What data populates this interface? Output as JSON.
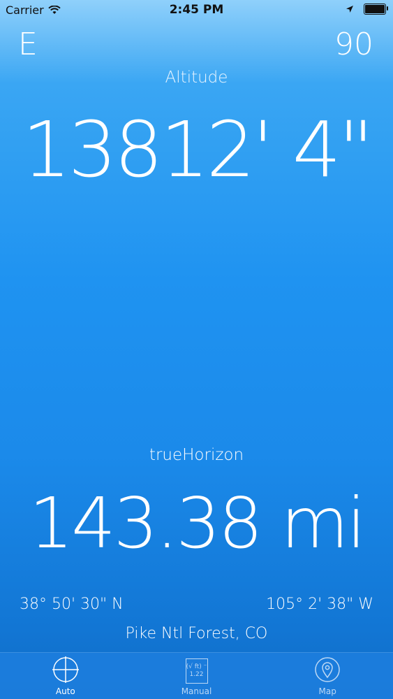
{
  "status": {
    "carrier": "Carrier",
    "time": "2:45 PM"
  },
  "heading": {
    "direction": "E",
    "degrees": "90"
  },
  "altitude": {
    "label": "Altitude",
    "value": "13812' 4\""
  },
  "horizon": {
    "label": "trueHorizon",
    "value": "143.38 mi"
  },
  "location": {
    "latitude": "38° 50' 30\" N",
    "longitude": "105° 2' 38\" W",
    "place": "Pike Ntl Forest, CO"
  },
  "tabs": [
    {
      "label": "Auto",
      "icon": "crosshair-icon",
      "active": true
    },
    {
      "label": "Manual",
      "icon": "manual-sqrt-icon",
      "active": false,
      "icon_text_top": "(√ ft) ⁻",
      "icon_text_bottom": "1.22"
    },
    {
      "label": "Map",
      "icon": "map-pin-icon",
      "active": false
    }
  ],
  "colors": {
    "accent": "#1f93f1",
    "tab_bar": "#1c7cdc",
    "inactive_tab": "#bcd8f5"
  }
}
